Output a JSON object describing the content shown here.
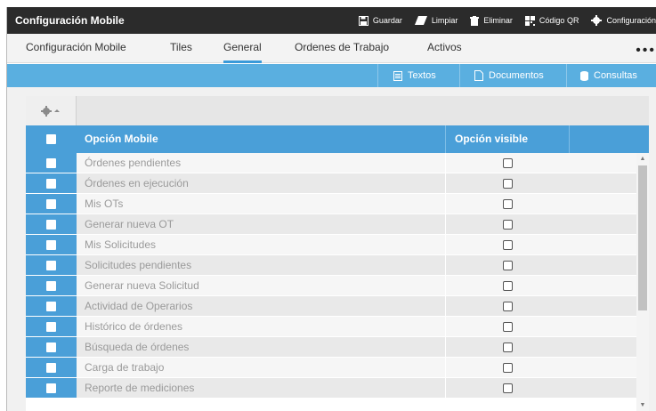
{
  "titlebar": {
    "title": "Configuración Mobile",
    "actions": [
      {
        "label": "Guardar",
        "icon": "save-icon"
      },
      {
        "label": "Limpiar",
        "icon": "eraser-icon"
      },
      {
        "label": "Eliminar",
        "icon": "trash-icon"
      },
      {
        "label": "Código QR",
        "icon": "qr-code-icon"
      },
      {
        "label": "Configuración",
        "icon": "gear-icon"
      }
    ]
  },
  "tabs": [
    {
      "label": "Configuración Mobile",
      "active": false
    },
    {
      "label": "Tiles",
      "active": false
    },
    {
      "label": "General",
      "active": true
    },
    {
      "label": "Ordenes de Trabajo",
      "active": false
    },
    {
      "label": "Activos",
      "active": false
    }
  ],
  "more_label": "•••",
  "subbar": {
    "buttons": [
      {
        "label": "Textos",
        "icon": "document-text-icon"
      },
      {
        "label": "Documentos",
        "icon": "file-icon"
      },
      {
        "label": "Consultas",
        "icon": "database-icon"
      }
    ]
  },
  "grid": {
    "columns": [
      "Opción Mobile",
      "Opción visible"
    ],
    "rows": [
      {
        "label": "Órdenes pendientes",
        "visible": false
      },
      {
        "label": "Órdenes en ejecución",
        "visible": false
      },
      {
        "label": "Mis OTs",
        "visible": false
      },
      {
        "label": "Generar nueva OT",
        "visible": false
      },
      {
        "label": "Mis Solicitudes",
        "visible": false
      },
      {
        "label": "Solicitudes pendientes",
        "visible": false
      },
      {
        "label": "Generar nueva Solicitud",
        "visible": false
      },
      {
        "label": "Actividad de Operarios",
        "visible": false
      },
      {
        "label": "Histórico de órdenes",
        "visible": false
      },
      {
        "label": "Búsqueda de órdenes",
        "visible": false
      },
      {
        "label": "Carga de trabajo",
        "visible": false
      },
      {
        "label": "Reporte de mediciones",
        "visible": false
      }
    ]
  },
  "colors": {
    "titlebar": "#2b2b2b",
    "accent": "#4a9fd8",
    "subbar": "#5aafe0"
  }
}
